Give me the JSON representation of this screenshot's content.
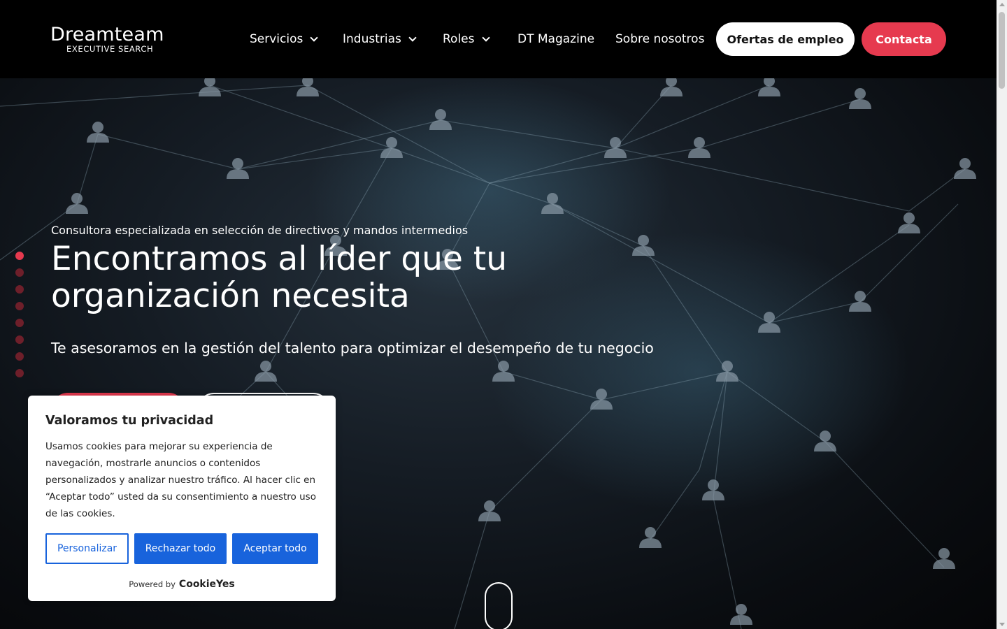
{
  "header": {
    "logo_word": "Dreamteam",
    "logo_sub": "EXECUTIVE SEARCH",
    "nav": [
      {
        "label": "Servicios",
        "has_dropdown": true
      },
      {
        "label": "Industrias",
        "has_dropdown": true
      },
      {
        "label": "Roles",
        "has_dropdown": true
      },
      {
        "label": "DT Magazine",
        "has_dropdown": false
      },
      {
        "label": "Sobre nosotros",
        "has_dropdown": false
      }
    ],
    "jobs_button": "Ofertas de empleo",
    "contact_button": "Contacta"
  },
  "hero": {
    "eyebrow": "Consultora especializada en selección de directivos y mandos intermedios",
    "headline": "Encontramos al líder que tu organización necesita",
    "subhead": "Te asesoramos en la gestión del talento para optimizar el desempeño de tu negocio",
    "slide_count": 8,
    "active_slide": 1
  },
  "cookie": {
    "title": "Valoramos tu privacidad",
    "text": "Usamos cookies para mejorar su experiencia de navegación, mostrarle anuncios o contenidos personalizados y analizar nuestro tráfico. Al hacer clic en “Aceptar todo” usted da su consentimiento a nuestro uso de las cookies.",
    "customize": "Personalizar",
    "reject": "Rechazar todo",
    "accept": "Aceptar todo",
    "powered_by": "Powered by",
    "powered_brand": "CookieYes"
  },
  "colors": {
    "accent_red": "#e63a4f",
    "cookie_blue": "#1863dc",
    "header_bg": "#000000"
  },
  "icons": [
    "chevron-down-icon",
    "person-node-icon",
    "scroll-mouse-icon"
  ]
}
